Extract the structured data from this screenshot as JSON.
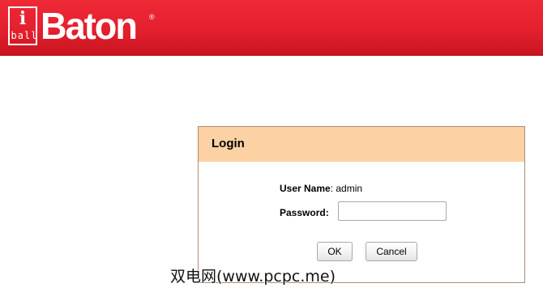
{
  "brand": {
    "logo_i": "i",
    "logo_ball": "ball",
    "logo_name": "Baton",
    "logo_reg": "®",
    "banner_color": "#e41f2e"
  },
  "login": {
    "title": "Login",
    "header_color": "#fcd1a4",
    "username_label": "User Name",
    "username_value": ": admin",
    "password_label": "Password:",
    "password_value": "",
    "ok_label": "OK",
    "cancel_label": "Cancel"
  },
  "watermark": "双电网(www.pcpc.me)"
}
